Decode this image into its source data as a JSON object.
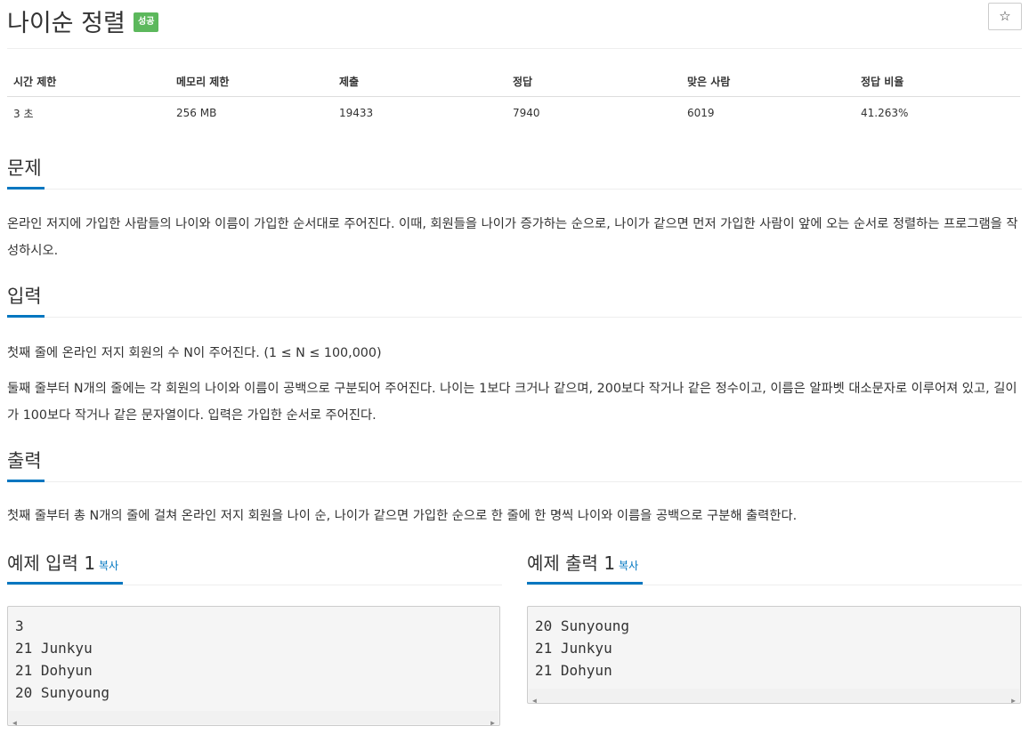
{
  "problem": {
    "title": "나이순 정렬",
    "status_badge": "성공",
    "star_icon": "☆"
  },
  "info_table": {
    "headers": [
      "시간 제한",
      "메모리 제한",
      "제출",
      "정답",
      "맞은 사람",
      "정답 비율"
    ],
    "values": [
      "3 초",
      "256 MB",
      "19433",
      "7940",
      "6019",
      "41.263%"
    ]
  },
  "sections": {
    "description": {
      "heading": "문제",
      "text": "온라인 저지에 가입한 사람들의 나이와 이름이 가입한 순서대로 주어진다. 이때, 회원들을 나이가 증가하는 순으로, 나이가 같으면 먼저 가입한 사람이 앞에 오는 순서로 정렬하는 프로그램을 작성하시오."
    },
    "input": {
      "heading": "입력",
      "line1": "첫째 줄에 온라인 저지 회원의 수 N이 주어진다. (1 ≤ N ≤ 100,000)",
      "line2": "둘째 줄부터 N개의 줄에는 각 회원의 나이와 이름이 공백으로 구분되어 주어진다. 나이는 1보다 크거나 같으며, 200보다 작거나 같은 정수이고, 이름은 알파벳 대소문자로 이루어져 있고, 길이가 100보다 작거나 같은 문자열이다. 입력은 가입한 순서로 주어진다."
    },
    "output": {
      "heading": "출력",
      "text": "첫째 줄부터 총 N개의 줄에 걸쳐 온라인 저지 회원을 나이 순, 나이가 같으면 가입한 순으로 한 줄에 한 명씩 나이와 이름을 공백으로 구분해 출력한다."
    }
  },
  "samples": {
    "input": {
      "heading": "예제 입력 1",
      "copy_label": "복사",
      "content": "3\n21 Junkyu\n21 Dohyun\n20 Sunyoung"
    },
    "output": {
      "heading": "예제 출력 1",
      "copy_label": "복사",
      "content": "20 Sunyoung\n21 Junkyu\n21 Dohyun"
    }
  }
}
